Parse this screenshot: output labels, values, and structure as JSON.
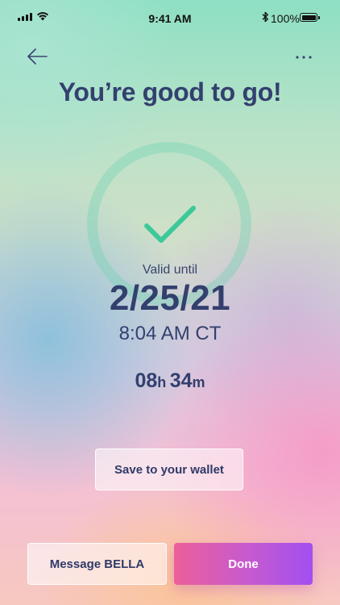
{
  "status_bar": {
    "time": "9:41 AM",
    "battery_percent": "100%",
    "icons": [
      "signal-icon",
      "wifi-icon",
      "bluetooth-icon",
      "battery-icon"
    ]
  },
  "header": {
    "back_icon": "arrow-left-icon",
    "more_icon": "more-dots-icon"
  },
  "title": "You’re good to go!",
  "pass": {
    "check_icon": "checkmark-icon",
    "valid_label": "Valid until",
    "date": "2/25/21",
    "time": "8:04 AM CT",
    "countdown": {
      "hours": "08",
      "hours_unit": "h",
      "minutes": "34",
      "minutes_unit": "m"
    }
  },
  "actions": {
    "wallet_label": "Save to your wallet",
    "message_label": "Message BELLA",
    "done_label": "Done"
  },
  "colors": {
    "text_primary": "#34406f",
    "check_green": "#3dc99a",
    "done_gradient_start": "#ec5f9a",
    "done_gradient_end": "#a24ff0"
  }
}
